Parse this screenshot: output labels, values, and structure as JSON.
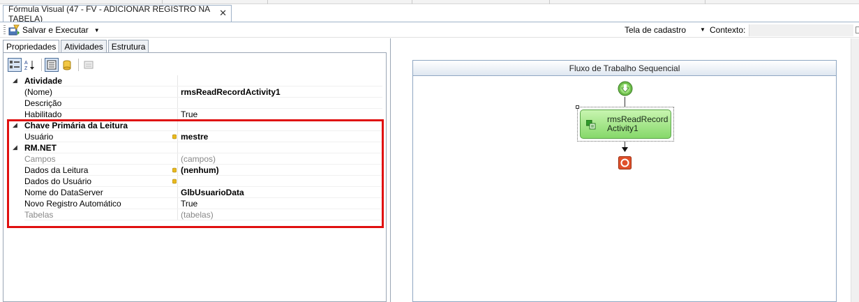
{
  "document_tab": {
    "title": "Fórmula Visual (47 - FV - ADICIONAR REGISTRO NA TABELA)",
    "close": "✕"
  },
  "toolbar": {
    "save_run_label": "Salvar e Executar",
    "screen_label": "Tela de cadastro",
    "context_label": "Contexto:",
    "dropdown_glyph": "▼"
  },
  "panel_tabs": [
    "Propriedades",
    "Atividades",
    "Estrutura"
  ],
  "properties": {
    "categories": [
      {
        "label": "Atividade",
        "rows": [
          {
            "name": "(Nome)",
            "value": "rmsReadRecordActivity1",
            "bold": true,
            "gray": false,
            "db": false
          },
          {
            "name": "Descrição",
            "value": "",
            "bold": false,
            "gray": false,
            "db": false
          },
          {
            "name": "Habilitado",
            "value": "True",
            "bold": false,
            "gray": false,
            "db": false
          }
        ]
      },
      {
        "label": "Chave Primária da Leitura",
        "rows": [
          {
            "name": "Usuário",
            "value": "mestre",
            "bold": true,
            "gray": false,
            "db": true
          }
        ]
      },
      {
        "label": "RM.NET",
        "rows": [
          {
            "name": "Campos",
            "value": "(campos)",
            "bold": false,
            "gray": true,
            "db": false
          },
          {
            "name": "Dados da Leitura",
            "value": "(nenhum)",
            "bold": true,
            "gray": false,
            "db": true
          },
          {
            "name": "Dados do Usuário",
            "value": "",
            "bold": false,
            "gray": false,
            "db": true
          },
          {
            "name": "Nome do DataServer",
            "value": "GlbUsuarioData",
            "bold": true,
            "gray": false,
            "db": false
          },
          {
            "name": "Novo Registro Automático",
            "value": "True",
            "bold": false,
            "gray": false,
            "db": false
          },
          {
            "name": "Tabelas",
            "value": "(tabelas)",
            "bold": false,
            "gray": true,
            "db": false
          }
        ]
      }
    ]
  },
  "workflow": {
    "title": "Fluxo de Trabalho Sequencial",
    "activity_label": "rmsReadRecordActivity1"
  },
  "colors": {
    "highlight_border": "#e01010",
    "activity_fill": "#a8e890",
    "start_icon": "#6dbb4a",
    "end_icon": "#e0502a"
  }
}
